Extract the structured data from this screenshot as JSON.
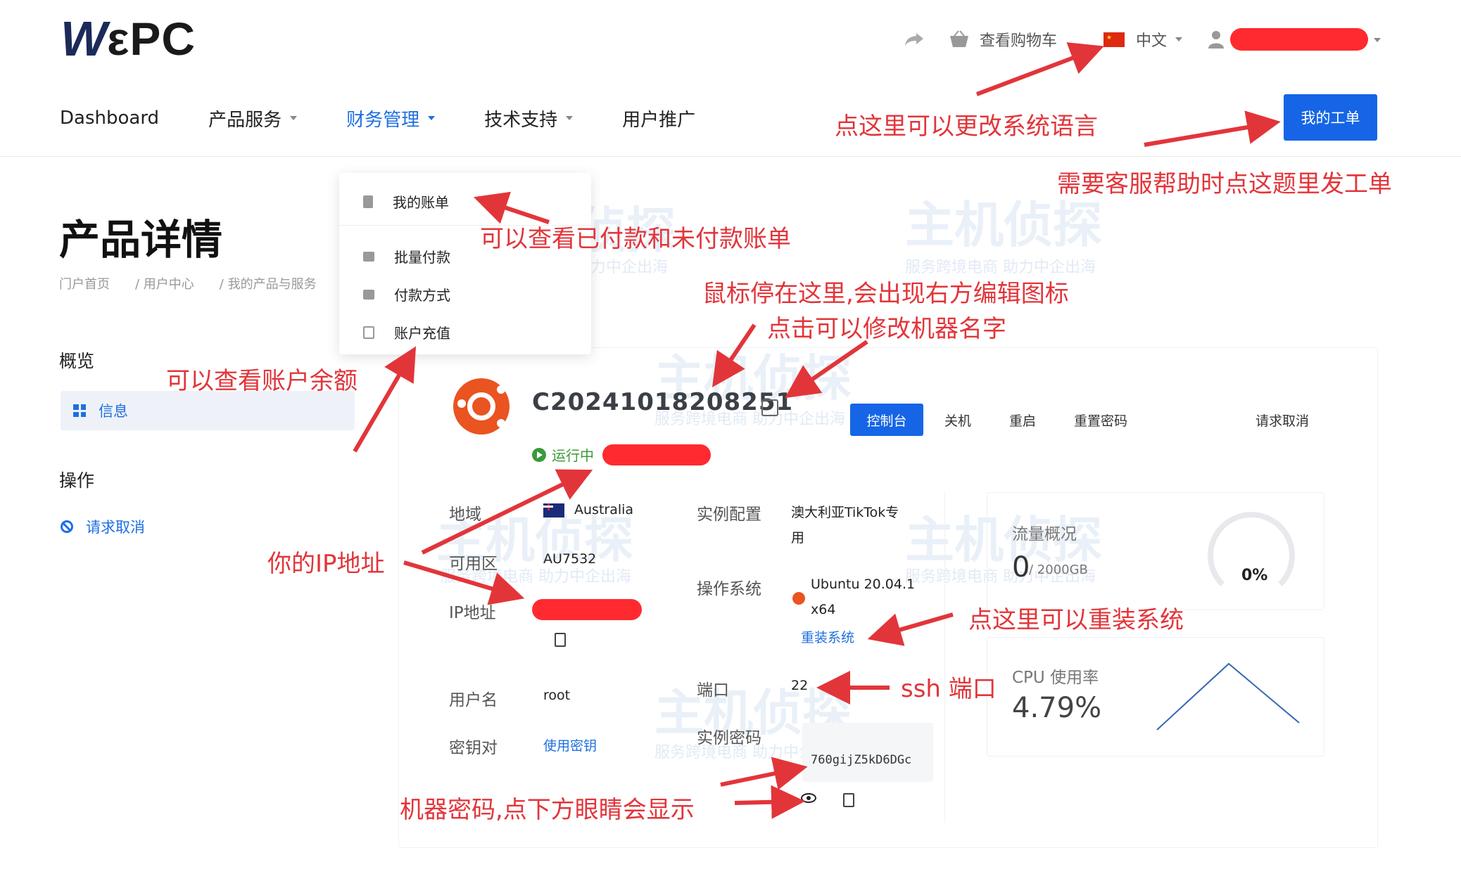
{
  "header": {
    "logo_w": "W",
    "logo_rest": "εPC",
    "cart_label": "查看购物车",
    "language": "中文"
  },
  "nav": {
    "items": [
      {
        "label": "Dashboard",
        "has_caret": false,
        "active": false
      },
      {
        "label": "产品服务",
        "has_caret": true,
        "active": false
      },
      {
        "label": "财务管理",
        "has_caret": true,
        "active": true
      },
      {
        "label": "技术支持",
        "has_caret": true,
        "active": false
      },
      {
        "label": "用户推广",
        "has_caret": false,
        "active": false
      }
    ],
    "ticket_button": "我的工单"
  },
  "finance_menu": {
    "items": [
      "我的账单",
      "批量付款",
      "付款方式",
      "账户充值"
    ]
  },
  "page": {
    "title": "产品详情",
    "breadcrumb": [
      "门户首页",
      "/ 用户中心",
      "/ 我的产品与服务"
    ]
  },
  "sidebar": {
    "overview_heading": "概览",
    "overview_item": "信息",
    "ops_heading": "操作",
    "ops_item": "请求取消"
  },
  "instance": {
    "name": "C20241018208251",
    "status": "运行中",
    "actions": [
      "控制台",
      "关机",
      "重启",
      "重置密码"
    ],
    "cancel_action": "请求取消",
    "labels": {
      "region": "地域",
      "zone": "可用区",
      "ip": "IP地址",
      "username": "用户名",
      "keypair": "密钥对",
      "config": "实例配置",
      "os": "操作系统",
      "port": "端口",
      "password": "实例密码"
    },
    "values": {
      "region": "Australia",
      "zone": "AU7532",
      "username": "root",
      "keypair": "使用密钥",
      "config_line1": "澳大利亚TikTok专",
      "config_line2": "用",
      "os_line1": "Ubuntu 20.04.1",
      "os_line2": "x64",
      "reinstall": "重装系统",
      "port": "22",
      "password": "760gijZ5kD6DGc"
    }
  },
  "stats": {
    "traffic_title": "流量概况",
    "traffic_used": "0",
    "traffic_total": "/ 2000GB",
    "traffic_percent": "0%",
    "cpu_title": "CPU 使用率",
    "cpu_value": "4.79%"
  },
  "annotations": {
    "language": "点这里可以更改系统语言",
    "ticket": "需要客服帮助时点这题里发工单",
    "bills": "可以查看已付款和未付款账单",
    "hover_edit": "鼠标停在这里,会出现右方编辑图标",
    "rename": "点击可以修改机器名字",
    "balance": "可以查看账户余额",
    "ip": "你的IP地址",
    "reinstall": "点这里可以重装系统",
    "ssh": "ssh 端口",
    "password": "机器密码,点下方眼睛会显示"
  },
  "watermark": {
    "main": "主机侦探",
    "sub": "服务跨境电商 助力中企出海"
  },
  "colors": {
    "primary": "#1565e6",
    "annotation": "#e2353a",
    "ubuntu": "#e95420",
    "running": "#3a9a3a"
  }
}
